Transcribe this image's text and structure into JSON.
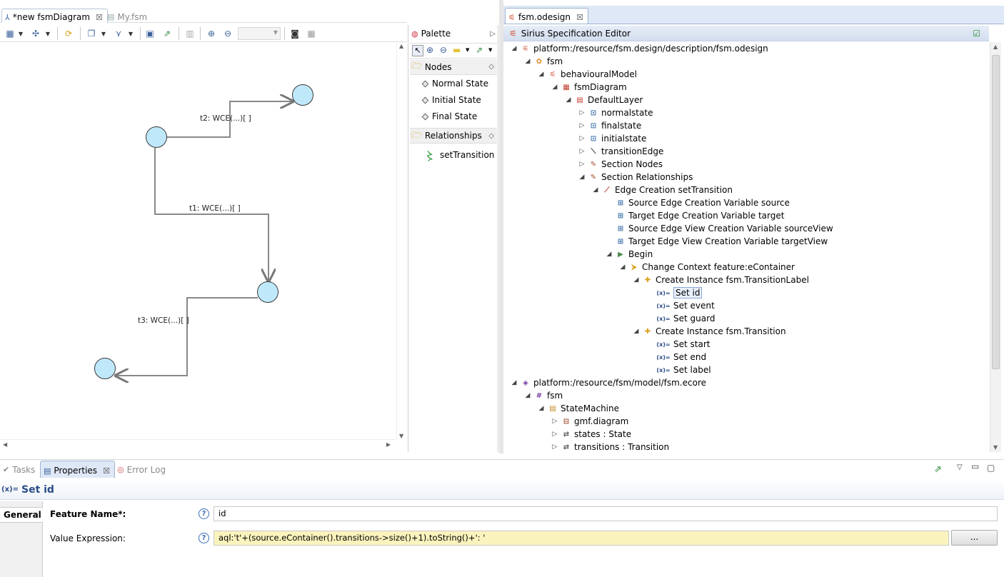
{
  "left_editor": {
    "tabs": [
      {
        "label": "*new fsmDiagram",
        "icon": "diagram-icon"
      },
      {
        "label": "My.fsm",
        "icon": "file-icon"
      }
    ],
    "diagram": {
      "edge_labels": [
        "t2: WCE(...)[ ]",
        "t1: WCE(...)[ ]",
        "t3: WCE(...)[ ]"
      ]
    }
  },
  "palette": {
    "title": "Palette",
    "groups": [
      {
        "label": "Nodes",
        "items": [
          "Normal State",
          "Initial State",
          "Final State"
        ]
      },
      {
        "label": "Relationships",
        "items": [
          "setTransition"
        ]
      }
    ]
  },
  "right_editor": {
    "tab": "fsm.odesign",
    "header": "Sirius Specification Editor",
    "tree": [
      {
        "label": "platform:/resource/fsm.design/description/fsm.odesign",
        "twisty": "◢",
        "icon": "odesign-icon"
      },
      {
        "label": "fsm",
        "twisty": "◢",
        "icon": "viewpoint-icon"
      },
      {
        "label": "behaviouralModel",
        "twisty": "◢",
        "icon": "model-icon"
      },
      {
        "label": "fsmDiagram",
        "twisty": "◢",
        "icon": "diagram-icon"
      },
      {
        "label": "DefaultLayer",
        "twisty": "◢",
        "icon": "layer-icon"
      },
      {
        "label": "normalstate",
        "twisty": "▷",
        "icon": "node-icon"
      },
      {
        "label": "finalstate",
        "twisty": "▷",
        "icon": "node-icon"
      },
      {
        "label": "initialstate",
        "twisty": "▷",
        "icon": "node-icon"
      },
      {
        "label": "transitionEdge",
        "twisty": "▷",
        "icon": "edge-icon"
      },
      {
        "label": "Section Nodes",
        "twisty": "▷",
        "icon": "section-icon"
      },
      {
        "label": "Section Relationships",
        "twisty": "◢",
        "icon": "section-icon"
      },
      {
        "label": "Edge Creation setTransition",
        "twisty": "◢",
        "icon": "edge-creation-icon"
      },
      {
        "label": "Source Edge Creation Variable source",
        "twisty": "",
        "icon": "variable-icon"
      },
      {
        "label": "Target Edge Creation Variable target",
        "twisty": "",
        "icon": "variable-icon"
      },
      {
        "label": "Source Edge View Creation Variable sourceView",
        "twisty": "",
        "icon": "variable-icon"
      },
      {
        "label": "Target Edge View Creation Variable targetView",
        "twisty": "",
        "icon": "variable-icon"
      },
      {
        "label": "Begin",
        "twisty": "◢",
        "icon": "begin-icon"
      },
      {
        "label": "Change Context feature:eContainer",
        "twisty": "◢",
        "icon": "context-icon"
      },
      {
        "label": "Create Instance fsm.TransitionLabel",
        "twisty": "◢",
        "icon": "create-instance-icon"
      },
      {
        "label": "Set id",
        "twisty": "",
        "icon": "set-icon"
      },
      {
        "label": "Set event",
        "twisty": "",
        "icon": "set-icon"
      },
      {
        "label": "Set guard",
        "twisty": "",
        "icon": "set-icon"
      },
      {
        "label": "Create Instance fsm.Transition",
        "twisty": "◢",
        "icon": "create-instance-icon"
      },
      {
        "label": "Set start",
        "twisty": "",
        "icon": "set-icon"
      },
      {
        "label": "Set end",
        "twisty": "",
        "icon": "set-icon"
      },
      {
        "label": "Set label",
        "twisty": "",
        "icon": "set-icon"
      },
      {
        "label": "platform:/resource/fsm/model/fsm.ecore",
        "twisty": "◢",
        "icon": "ecore-icon"
      },
      {
        "label": "fsm",
        "twisty": "◢",
        "icon": "package-icon"
      },
      {
        "label": "StateMachine",
        "twisty": "◢",
        "icon": "class-icon"
      },
      {
        "label": "gmf.diagram",
        "twisty": "▷",
        "icon": "annotation-icon"
      },
      {
        "label": "states : State",
        "twisty": "▷",
        "icon": "reference-icon"
      },
      {
        "label": "transitions : Transition",
        "twisty": "▷",
        "icon": "reference-icon"
      }
    ]
  },
  "bottom": {
    "tabs": [
      {
        "label": "Tasks",
        "icon": "tasks-icon"
      },
      {
        "label": "Properties",
        "icon": "properties-icon"
      },
      {
        "label": "Error Log",
        "icon": "error-log-icon"
      }
    ],
    "title": "Set id",
    "title_prefix": "(x)=",
    "section_tab": "General",
    "fields": {
      "feature_name_label": "Feature Name*:",
      "feature_name_value": "id",
      "value_expression_label": "Value Expression:",
      "value_expression_value": "aql:'t'+(source.eContainer().transitions->size()+1).toString()+': '",
      "browse_label": "..."
    }
  }
}
